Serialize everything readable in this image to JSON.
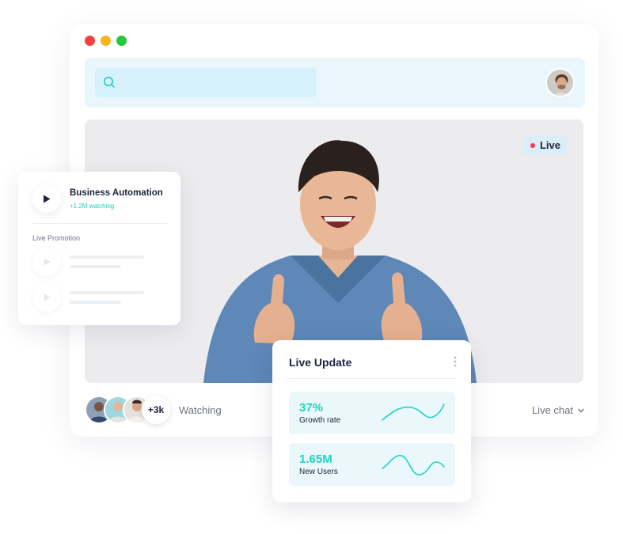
{
  "window": {
    "traffic_lights": [
      "close",
      "minimize",
      "maximize"
    ],
    "search": {
      "placeholder": "",
      "icon": "search-icon"
    }
  },
  "video": {
    "live_label": "Live"
  },
  "footer": {
    "viewers_more": "+3k",
    "watching_label": "Watching",
    "live_chat_label": "Live chat"
  },
  "side_card": {
    "featured": {
      "title": "Business Automation",
      "subtitle": "+1.2M watching"
    },
    "section_label": "Live Promotion"
  },
  "live_update": {
    "title": "Live Update",
    "stats": [
      {
        "value": "37%",
        "label": "Growth rate"
      },
      {
        "value": "1.65M",
        "label": "New Users"
      }
    ]
  },
  "colors": {
    "accent": "#1fd3c2",
    "live_dot": "#ef3b4e",
    "topbar_bg": "#e9f7fd",
    "text_dark": "#1e2240"
  }
}
